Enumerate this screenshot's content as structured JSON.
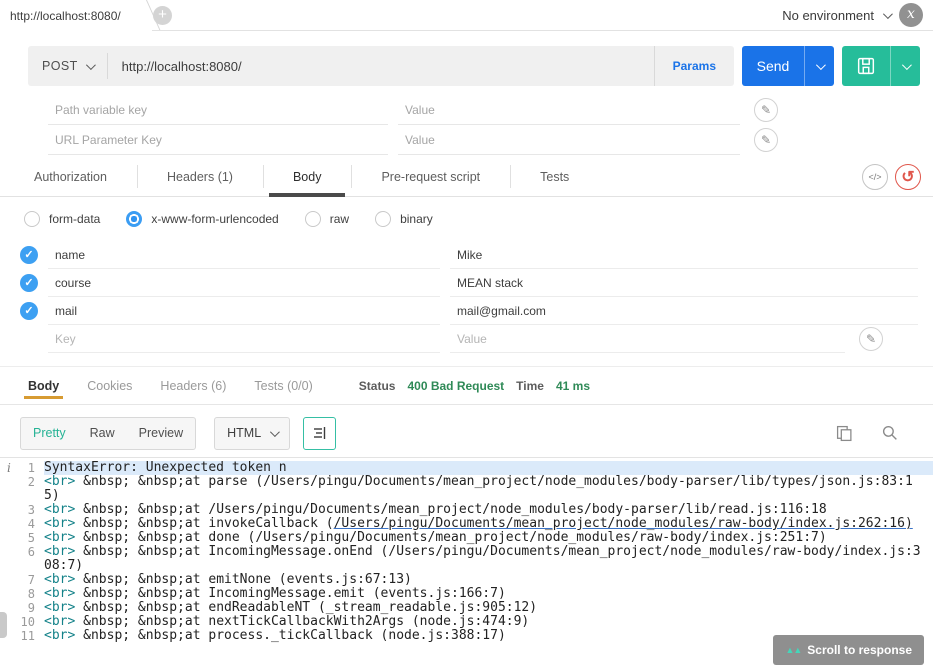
{
  "topbar": {
    "tab_title": "http://localhost:8080/",
    "environment": "No environment",
    "avatar_letter": "x"
  },
  "request": {
    "method": "POST",
    "url": "http://localhost:8080/",
    "params_label": "Params",
    "send_label": "Send",
    "path_variable": {
      "key_placeholder": "Path variable key",
      "value_placeholder": "Value"
    },
    "url_parameter": {
      "key_placeholder": "URL Parameter Key",
      "value_placeholder": "Value"
    },
    "tabs": [
      {
        "label": "Authorization",
        "active": false
      },
      {
        "label": "Headers (1)",
        "active": false
      },
      {
        "label": "Body",
        "active": true
      },
      {
        "label": "Pre-request script",
        "active": false
      },
      {
        "label": "Tests",
        "active": false
      }
    ],
    "body_modes": [
      {
        "label": "form-data",
        "selected": false
      },
      {
        "label": "x-www-form-urlencoded",
        "selected": true
      },
      {
        "label": "raw",
        "selected": false
      },
      {
        "label": "binary",
        "selected": false
      }
    ],
    "form_rows": [
      {
        "key": "name",
        "value": "Mike",
        "checked": true
      },
      {
        "key": "course",
        "value": "MEAN stack",
        "checked": true
      },
      {
        "key": "mail",
        "value": "mail@gmail.com",
        "checked": true
      }
    ],
    "empty_row": {
      "key_placeholder": "Key",
      "value_placeholder": "Value"
    }
  },
  "response": {
    "tabs": [
      "Body",
      "Cookies",
      "Headers (6)",
      "Tests (0/0)"
    ],
    "active_tab": "Body",
    "status_label": "Status",
    "status_value": "400 Bad Request",
    "time_label": "Time",
    "time_value": "41 ms",
    "view_modes": [
      "Pretty",
      "Raw",
      "Preview"
    ],
    "active_view": "Pretty",
    "format_select": "HTML",
    "code_lines": [
      {
        "num": "1",
        "highlight": true,
        "gutter_icon": "i",
        "segments": [
          {
            "style": "plain",
            "text": "SyntaxError: Unexpected token n"
          }
        ]
      },
      {
        "num": "2",
        "segments": [
          {
            "style": "tag",
            "text": "<br>"
          },
          {
            "style": "plain",
            "text": " &nbsp; &nbsp;at parse (/Users/pingu/Documents/mean_project/node_modules/body-parser/lib/types/json.js:83:15)"
          }
        ]
      },
      {
        "num": "3",
        "segments": [
          {
            "style": "tag",
            "text": "<br>"
          },
          {
            "style": "plain",
            "text": " &nbsp; &nbsp;at /Users/pingu/Documents/mean_project/node_modules/body-parser/lib/read.js:116:18"
          }
        ]
      },
      {
        "num": "4",
        "segments": [
          {
            "style": "tag",
            "text": "<br>"
          },
          {
            "style": "plain",
            "text": " &nbsp; &nbsp;at invokeCallback ("
          },
          {
            "style": "link",
            "text": "/Users/pingu/Documents/mean_project/node_modules/raw-body/index.js:262:16)"
          }
        ]
      },
      {
        "num": "5",
        "segments": [
          {
            "style": "tag",
            "text": "<br>"
          },
          {
            "style": "plain",
            "text": " &nbsp; &nbsp;at done (/Users/pingu/Documents/mean_project/node_modules/raw-body/index.js:251:7)"
          }
        ]
      },
      {
        "num": "6",
        "segments": [
          {
            "style": "tag",
            "text": "<br>"
          },
          {
            "style": "plain",
            "text": " &nbsp; &nbsp;at IncomingMessage.onEnd (/Users/pingu/Documents/mean_project/node_modules/raw-body/index.js:308:7)"
          }
        ]
      },
      {
        "num": "7",
        "segments": [
          {
            "style": "tag",
            "text": "<br>"
          },
          {
            "style": "plain",
            "text": " &nbsp; &nbsp;at emitNone (events.js:67:13)"
          }
        ]
      },
      {
        "num": "8",
        "segments": [
          {
            "style": "tag",
            "text": "<br>"
          },
          {
            "style": "plain",
            "text": " &nbsp; &nbsp;at IncomingMessage.emit (events.js:166:7)"
          }
        ]
      },
      {
        "num": "9",
        "segments": [
          {
            "style": "tag",
            "text": "<br>"
          },
          {
            "style": "plain",
            "text": " &nbsp; &nbsp;at endReadableNT (_stream_readable.js:905:12)"
          }
        ]
      },
      {
        "num": "10",
        "segments": [
          {
            "style": "tag",
            "text": "<br>"
          },
          {
            "style": "plain",
            "text": " &nbsp; &nbsp;at nextTickCallbackWith2Args (node.js:474:9)"
          }
        ]
      },
      {
        "num": "11",
        "segments": [
          {
            "style": "tag",
            "text": "<br>"
          },
          {
            "style": "plain",
            "text": " &nbsp; &nbsp;at process._tickCallback (node.js:388:17)"
          }
        ]
      }
    ]
  },
  "scroll_button": {
    "label": "Scroll to response",
    "arrows": "▲▲"
  },
  "icons": {
    "code_glyph": "</>",
    "reset_glyph": "↺",
    "plus_glyph": "+",
    "check_glyph": "✓",
    "pencil_glyph": "✎"
  },
  "colors": {
    "send_button_blue": "#1a73e8",
    "save_button_teal": "#26bd9a",
    "params_link_blue": "#1a73e8",
    "checked_row_blue": "#3da0f2",
    "selected_radio_blue": "#2f93f0",
    "status_green": "#2f8a57",
    "response_active_tab_orange": "#d79b32",
    "code_tag_teal": "#148289",
    "error_line_highlight": "#dbeafa",
    "reset_icon_red": "#e0564b"
  }
}
